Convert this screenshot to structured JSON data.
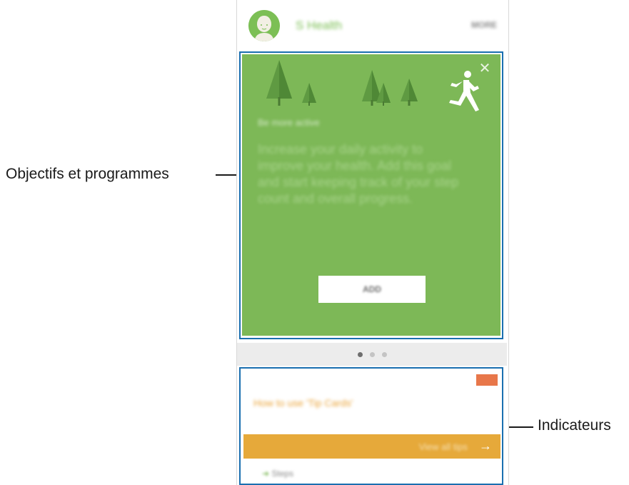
{
  "callouts": {
    "goals_label": "Objectifs et programmes",
    "indicators_label": "Indicateurs"
  },
  "header": {
    "app_title": "S Health",
    "more_label": "MORE"
  },
  "goal_card": {
    "subtitle": "Be more active",
    "body": "Increase your daily activity to improve your health. Add this goal and start keeping track of your step count and overall progress.",
    "add_button_label": "ADD",
    "close_glyph": "✕"
  },
  "page_indicator": {
    "count": 3,
    "active_index": 0
  },
  "tip_card": {
    "title": "How to use 'Tip Cards'",
    "view_all_label": "View all tips",
    "arrow_glyph": "→",
    "steps_label": "Steps"
  },
  "colors": {
    "goal_green": "#7db857",
    "tip_orange": "#e6a93a",
    "badge_orange": "#e8774a",
    "frame_blue": "#1a6fb0"
  }
}
